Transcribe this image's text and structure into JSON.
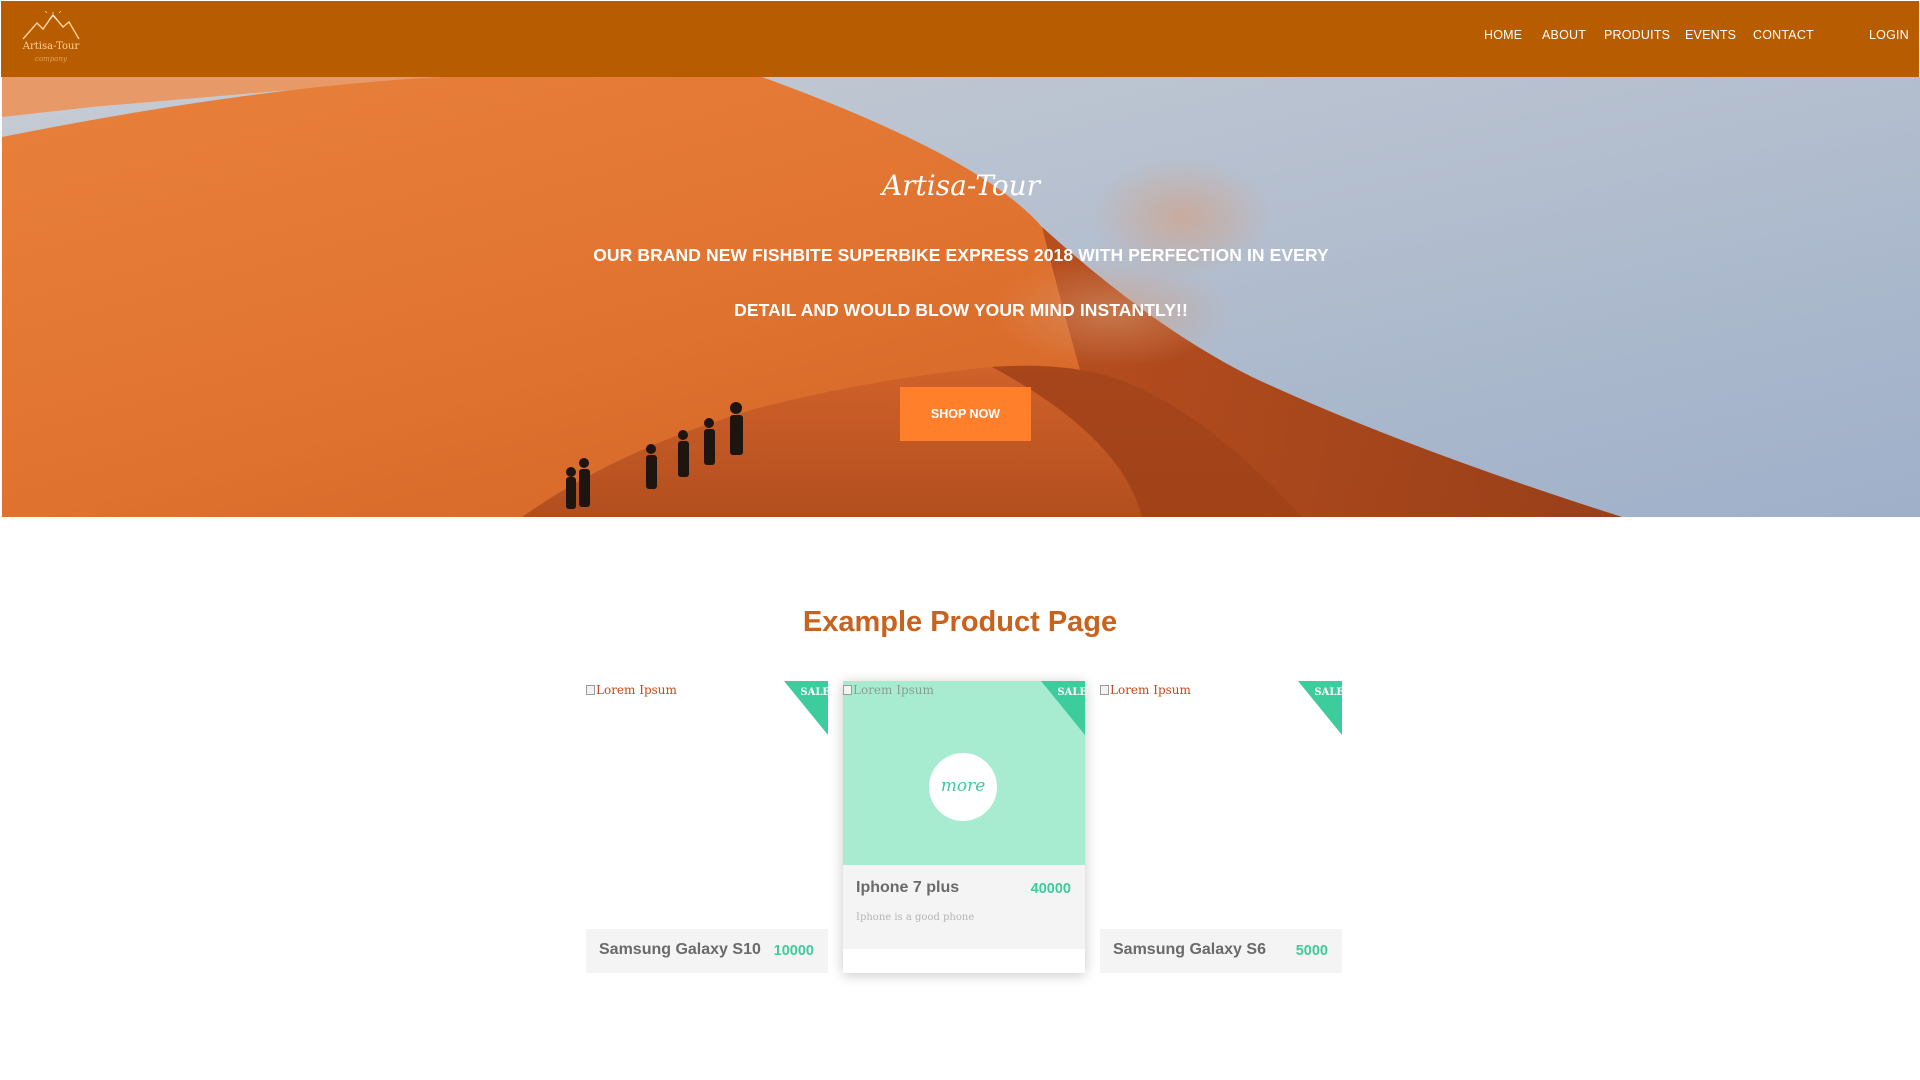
{
  "navbar": {
    "logo_text": "Artisa-Tour",
    "logo_subtext": "company",
    "links": [
      "HOME",
      "ABOUT",
      "PRODUITS",
      "EVENTS",
      "CONTACT"
    ],
    "login": "LOGIN",
    "color": "#b85c00"
  },
  "hero": {
    "title": "Artisa-Tour",
    "headline_line1": "OUR BRAND NEW FISHBITE SUPERBIKE EXPRESS 2018 WITH PERFECTION IN EVERY",
    "headline_line2": "DETAIL AND WOULD BLOW YOUR MIND INSTANTLY!!",
    "button_label": "SHOP NOW",
    "button_color": "#ff7f2a"
  },
  "products": {
    "section_title": "Example Product Page",
    "accent_color": "#3dcc9b",
    "items": [
      {
        "image_alt": "Lorem Ipsum",
        "sale_label": "SALE",
        "name": "Samsung Galaxy S10",
        "price": "10000"
      },
      {
        "image_alt": "Lorem Ipsum",
        "sale_label": "SALE",
        "more_label": "more",
        "name": "Iphone 7 plus",
        "price": "40000",
        "description": "Iphone is a good phone"
      },
      {
        "image_alt": "Lorem Ipsum",
        "sale_label": "SALE",
        "name": "Samsung Galaxy S6",
        "price": "5000"
      }
    ]
  }
}
